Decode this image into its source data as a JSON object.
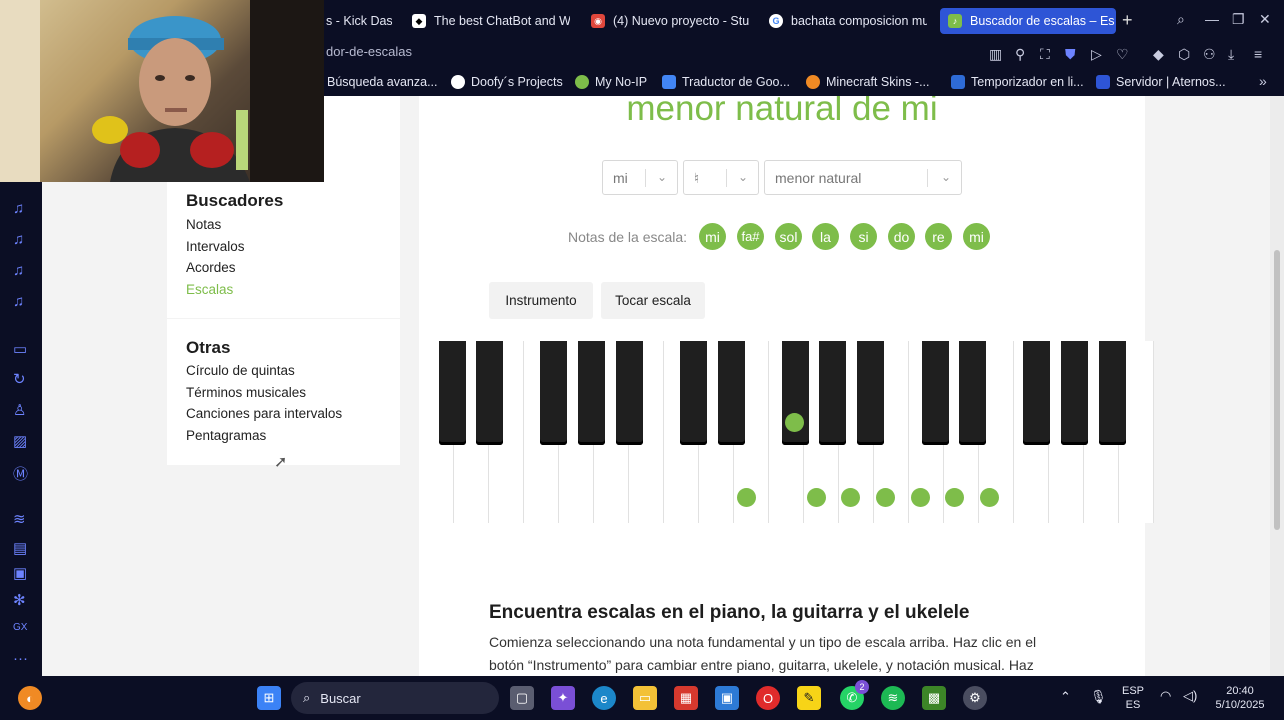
{
  "browser": {
    "tabs": [
      {
        "title": "s - Kick Das",
        "icon": "kick-favicon",
        "color": "#2e2e38"
      },
      {
        "title": "The best ChatBot and W",
        "icon": "chatbot-favicon",
        "color": "#ffffff"
      },
      {
        "title": "(4) Nuevo proyecto - Stu",
        "icon": "studio-favicon",
        "color": "#e0473c"
      },
      {
        "title": "bachata composicion mu",
        "icon": "google-favicon",
        "color": "#4285f4"
      },
      {
        "title": "Buscador de escalas – Es",
        "icon": "escalas-favicon",
        "color": "#7ebd4a"
      }
    ],
    "url": "dor-de-escalas",
    "bookmarks": [
      {
        "label": "Búsqueda avanza...",
        "color": "#ffffff"
      },
      {
        "label": "Doofy´s Projects",
        "color": "#ffffff"
      },
      {
        "label": "My No-IP",
        "color": "#7ebd4a"
      },
      {
        "label": "Traductor de Goo...",
        "color": "#4285f4"
      },
      {
        "label": "Minecraft Skins -...",
        "color": "#f08a24"
      },
      {
        "label": "Temporizador en li...",
        "color": "#2e6bd6"
      },
      {
        "label": "Servidor | Aternos...",
        "color": "#2e55d6"
      }
    ]
  },
  "sidebar": {
    "buscadores_heading": "Buscadores",
    "buscadores": [
      "Notas",
      "Intervalos",
      "Acordes",
      "Escalas"
    ],
    "otras_heading": "Otras",
    "otras": [
      "Círculo de quintas",
      "Términos musicales",
      "Canciones para intervalos",
      "Pentagramas"
    ]
  },
  "scale": {
    "title": "menor natural de mi",
    "root_select": "mi",
    "accidental_select": "♮",
    "type_select": "menor natural",
    "notes_label": "Notas de la escala:",
    "notes": [
      "mi",
      "fa#",
      "sol",
      "la",
      "si",
      "do",
      "re",
      "mi"
    ],
    "instrument_button": "Instrumento",
    "play_button": "Tocar escala",
    "accent_color": "#7ebd4a"
  },
  "article": {
    "heading": "Encuentra escalas en el piano, la guitarra y el ukelele",
    "line1": "Comienza seleccionando una nota fundamental y un tipo de escala arriba. Haz clic en el",
    "line2": "botón “Instrumento” para cambiar entre piano, guitarra, ukelele, y notación musical. Haz"
  },
  "taskbar": {
    "search_placeholder": "Buscar",
    "lang_top": "ESP",
    "lang_bottom": "ES",
    "time": "20:40",
    "date": "5/10/2025",
    "badge_count": "2"
  }
}
